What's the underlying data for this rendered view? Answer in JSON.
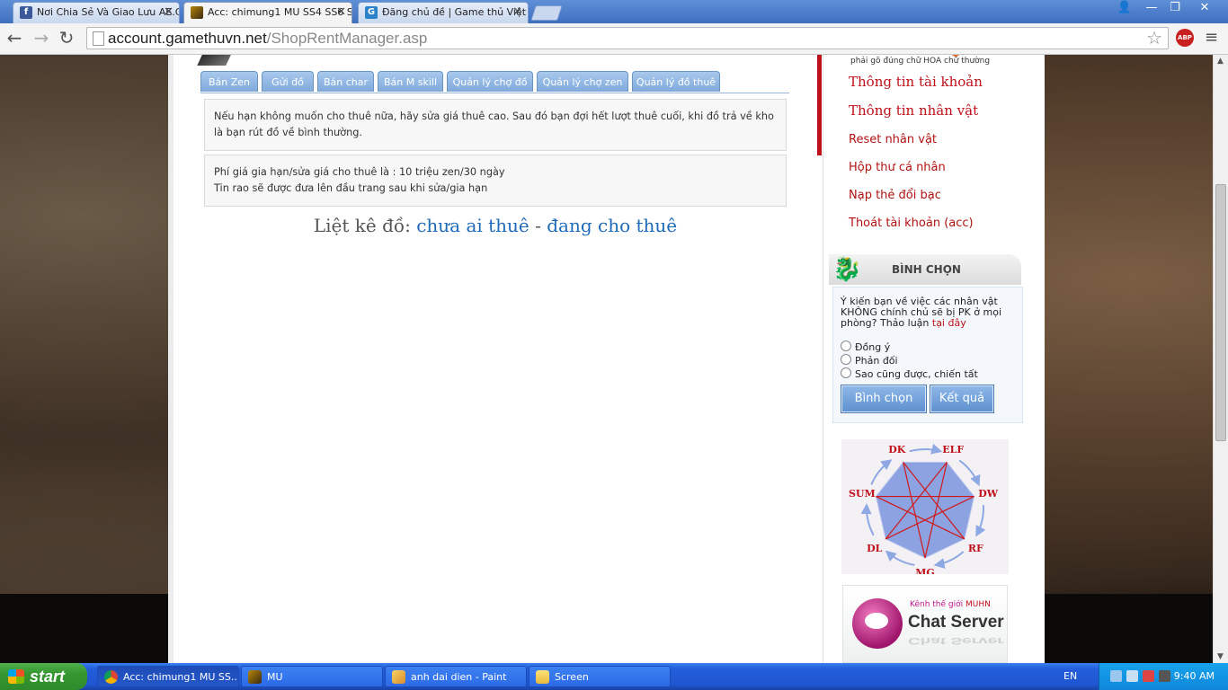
{
  "browser": {
    "tabs": [
      {
        "title": "Nơi Chia Sẻ Và Giao Lưu AE.C",
        "favicon": "facebook-icon",
        "active": false
      },
      {
        "title": "Acc: chimung1 MU SS4 SS6 S",
        "favicon": "mu-game-icon",
        "active": true
      },
      {
        "title": "Đăng chủ đề | Game thủ Việt",
        "favicon": "gamethu-icon",
        "active": false
      }
    ],
    "url_host": "account.gamethuvn.net",
    "url_path": "/ShopRentManager.asp",
    "abp_label": "ABP"
  },
  "page": {
    "tabs": [
      "Bán Zen",
      "Gửi đồ",
      "Bán char",
      "Bán M skill",
      "Quản lý chợ đồ",
      "Quản lý chợ zen",
      "Quản lý đồ thuê"
    ],
    "info1": "Nếu hạn không muốn cho thuê nữa, hãy sửa giá thuê cao. Sau đó bạn đợi hết lượt thuê cuối, khi đồ trả về kho là bạn rút đồ về bình thường.",
    "info2_line1": "Phí giá gia hạn/sửa giá cho thuê là : 10 triệu zen/30 ngày",
    "info2_line2": "Tin rao sẽ được đưa lên đầu trang sau khi sửa/gia hạn",
    "list_label": "Liệt kê đồ:",
    "list_link_unrented": "chưa ai thuê",
    "list_separator": "-",
    "list_link_renting": "đang cho thuê"
  },
  "sidebar": {
    "case_note": "phải gõ đúng chữ HOA chữ thường",
    "account_links": [
      "Thông tin tài khoản",
      "Thông tin nhân vật"
    ],
    "links": [
      "Reset nhân vật",
      "Hộp thư cá nhân",
      "Nạp thẻ đổi bạc",
      "Thoát tài khoản (acc)"
    ],
    "poll": {
      "title": "BÌNH CHỌN",
      "question": "Ý kiến bạn về việc các nhân vật KHÔNG chính chủ sẽ bị PK ở mọi phòng? Thảo luận",
      "question_link": "tại đây",
      "options": [
        "Đồng ý",
        "Phản đối",
        "Sao cũng được, chiến tất"
      ],
      "vote_button": "Bình chọn",
      "results_button": "Kết quả"
    },
    "class_diagram": {
      "labels": [
        "DK",
        "ELF",
        "DW",
        "RF",
        "MG",
        "DL",
        "SUM"
      ],
      "colors": {
        "fill": "#8da2e0",
        "arrow": "#8ea8e4",
        "line": "#d01818"
      }
    },
    "chat_banner": {
      "subtitle_prefix": "Kênh thế giới",
      "subtitle_brand": "MUHN",
      "title": "Chat Server"
    }
  },
  "taskbar": {
    "start_label": "start",
    "tasks": [
      {
        "label": "Acc: chimung1 MU SS...",
        "icon": "chrome-icon",
        "active": true
      },
      {
        "label": "MU",
        "icon": "mu-game-icon",
        "active": false
      },
      {
        "label": "anh dai dien - Paint",
        "icon": "paint-icon",
        "active": false
      },
      {
        "label": "Screen",
        "icon": "folder-icon",
        "active": false
      }
    ],
    "language": "EN",
    "clock": "9:40 AM"
  }
}
